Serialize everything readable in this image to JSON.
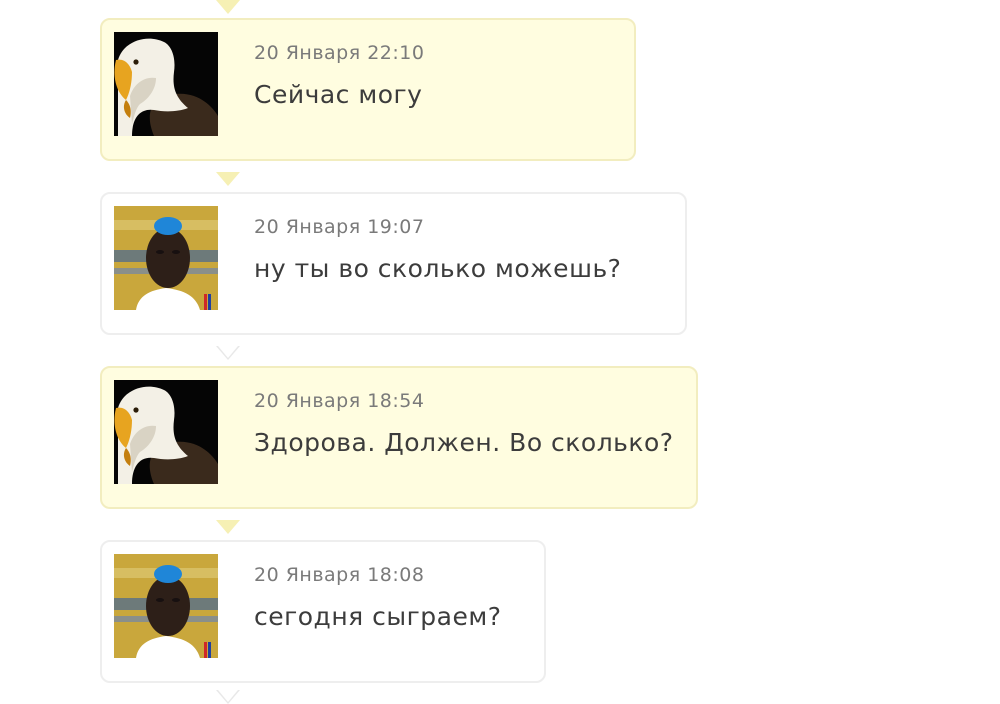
{
  "messages": [
    {
      "sender": "eagle",
      "time": "20 Января 22:10",
      "text": "Сейчас могу"
    },
    {
      "sender": "player",
      "time": "20 Января 19:07",
      "text": "ну ты во сколько можешь?"
    },
    {
      "sender": "eagle",
      "time": "20 Января 18:54",
      "text": "Здорова. Должен. Во сколько?"
    },
    {
      "sender": "player",
      "time": "20 Января 18:08",
      "text": "сегодня сыграем?"
    }
  ],
  "colors": {
    "own_bubble": "#fffde0",
    "own_border": "#f2edbf",
    "other_bubble": "#ffffff",
    "other_border": "#eeeeee",
    "timestamp": "#7a7a7a",
    "message_text": "#3c3c3c"
  }
}
